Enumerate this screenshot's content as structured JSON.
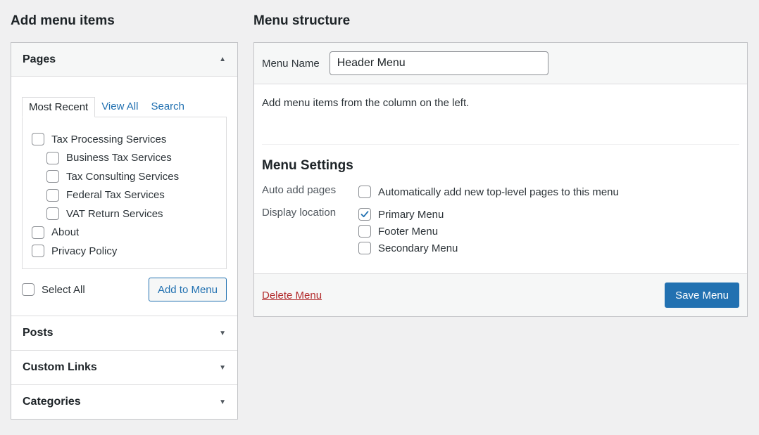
{
  "left": {
    "title": "Add menu items",
    "pages": {
      "title": "Pages",
      "arrow": "▲",
      "tabs": [
        "Most Recent",
        "View All",
        "Search"
      ],
      "items": [
        {
          "label": "Tax Processing Services",
          "child": false,
          "checked": false
        },
        {
          "label": "Business Tax Services",
          "child": true,
          "checked": false
        },
        {
          "label": "Tax Consulting Services",
          "child": true,
          "checked": false
        },
        {
          "label": "Federal Tax Services",
          "child": true,
          "checked": false
        },
        {
          "label": "VAT Return Services",
          "child": true,
          "checked": false
        },
        {
          "label": "About",
          "child": false,
          "checked": false
        },
        {
          "label": "Privacy Policy",
          "child": false,
          "checked": false
        }
      ],
      "select_all": "Select All",
      "add_button": "Add to Menu"
    },
    "sections": [
      {
        "title": "Posts",
        "arrow": "▼"
      },
      {
        "title": "Custom Links",
        "arrow": "▼"
      },
      {
        "title": "Categories",
        "arrow": "▼"
      }
    ]
  },
  "right": {
    "title": "Menu structure",
    "menu_name_label": "Menu Name",
    "menu_name_value": "Header Menu",
    "hint": "Add menu items from the column on the left.",
    "settings": {
      "title": "Menu Settings",
      "auto_add_label": "Auto add pages",
      "auto_add_option": "Automatically add new top-level pages to this menu",
      "auto_add_checked": false,
      "display_location_label": "Display location",
      "locations": [
        {
          "label": "Primary Menu",
          "checked": true
        },
        {
          "label": "Footer Menu",
          "checked": false
        },
        {
          "label": "Secondary Menu",
          "checked": false
        }
      ]
    },
    "delete_label": "Delete Menu",
    "save_label": "Save Menu"
  },
  "colors": {
    "accent": "#2271b1",
    "danger": "#b32d2e",
    "background": "#f0f0f1"
  }
}
